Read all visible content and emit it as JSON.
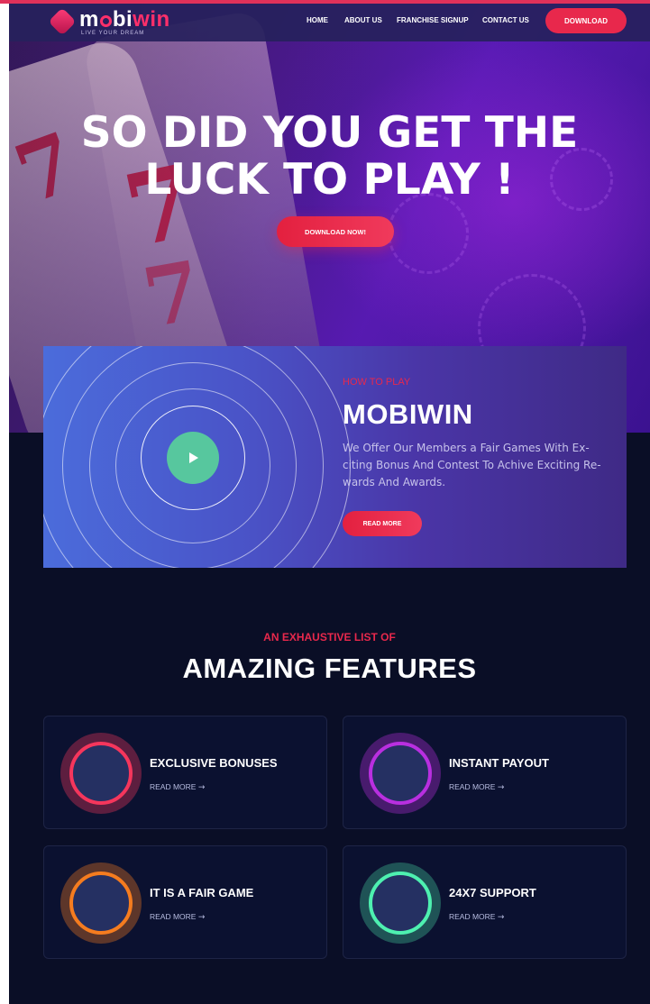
{
  "brand": {
    "name_part1": "m",
    "name_part2": "bi",
    "name_part3": "win",
    "tagline": "LIVE YOUR DREAM"
  },
  "nav": {
    "items": [
      "HOME",
      "ABOUT US",
      "FRANCHISE SIGNUP",
      "CONTACT US"
    ],
    "cta": "DOWNLOAD"
  },
  "hero": {
    "title_line1": "SO DID YOU GET THE",
    "title_line2": "LUCK TO PLAY !",
    "button": "DOWNLOAD NOW!"
  },
  "howto": {
    "kicker": "HOW TO PLAY",
    "title": "MOBIWIN",
    "description": "We Offer Our Members a Fair Games With Ex-citing Bonus And Contest To Achive Exciting Re-wards And Awards.",
    "button": "READ MORE"
  },
  "features": {
    "kicker": "AN EXHAUSTIVE LIST OF",
    "title": "AMAZING FEATURES",
    "cards": [
      {
        "title": "EXCLUSIVE BONUSES",
        "link": "READ MORE",
        "color": "#f5365c"
      },
      {
        "title": "INSTANT PAYOUT",
        "link": "READ MORE",
        "color": "#b92fe0"
      },
      {
        "title": "IT IS A FAIR GAME",
        "link": "READ MORE",
        "color": "#f57c1f"
      },
      {
        "title": "24X7 SUPPORT",
        "link": "READ MORE",
        "color": "#4ef0b0"
      }
    ]
  },
  "colors": {
    "accent": "#e8284c",
    "background": "#0a0e26",
    "play_button": "#57c79e"
  }
}
